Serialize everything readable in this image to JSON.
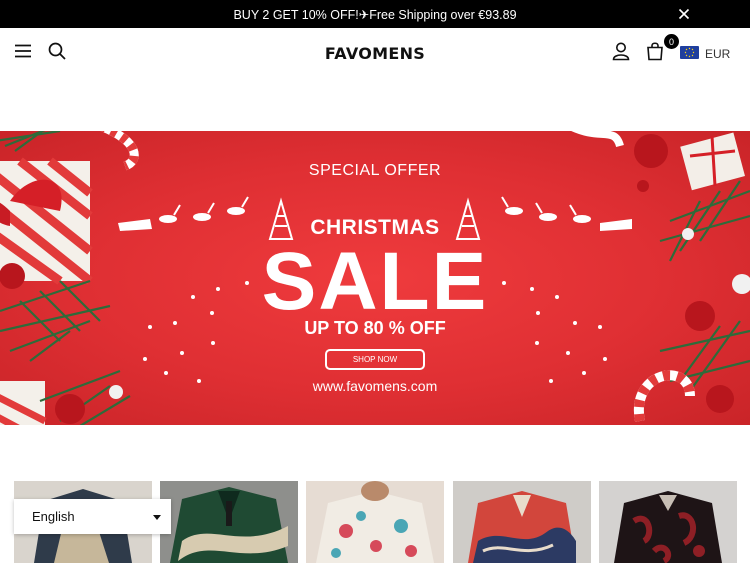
{
  "announcement": {
    "text": "BUY 2 GET 10% OFF!✈Free Shipping over €93.89"
  },
  "header": {
    "logo": "FAVOMENS",
    "cart_count": "0",
    "currency": "EUR"
  },
  "hero": {
    "special_offer": "SPECIAL OFFER",
    "christmas": "CHRISTMAS",
    "sale": "SALE",
    "discount": "UP TO 80 % OFF",
    "shop_now": "SHOP NOW",
    "url": "www.favomens.com"
  },
  "products": [
    {
      "name": "retro-print-shirt",
      "colors": [
        "#2f3b4a",
        "#c6b79a",
        "#8a3a2b"
      ]
    },
    {
      "name": "green-wave-shirt",
      "colors": [
        "#1f4a33",
        "#d7cbb0",
        "#0f2a1e"
      ]
    },
    {
      "name": "christmas-print-shirt",
      "colors": [
        "#f1ece4",
        "#d64a5a",
        "#4aa6b5"
      ]
    },
    {
      "name": "wave-patchwork-shirt",
      "colors": [
        "#d2463c",
        "#2c3a63",
        "#e8dccb"
      ]
    },
    {
      "name": "dark-red-pattern-shirt",
      "colors": [
        "#1e1416",
        "#8e1f25",
        "#c8bfb5"
      ]
    }
  ],
  "language_selector": {
    "selected": "English"
  },
  "colors": {
    "hero_red": "#e2363a",
    "announcement_bg": "#000000"
  }
}
